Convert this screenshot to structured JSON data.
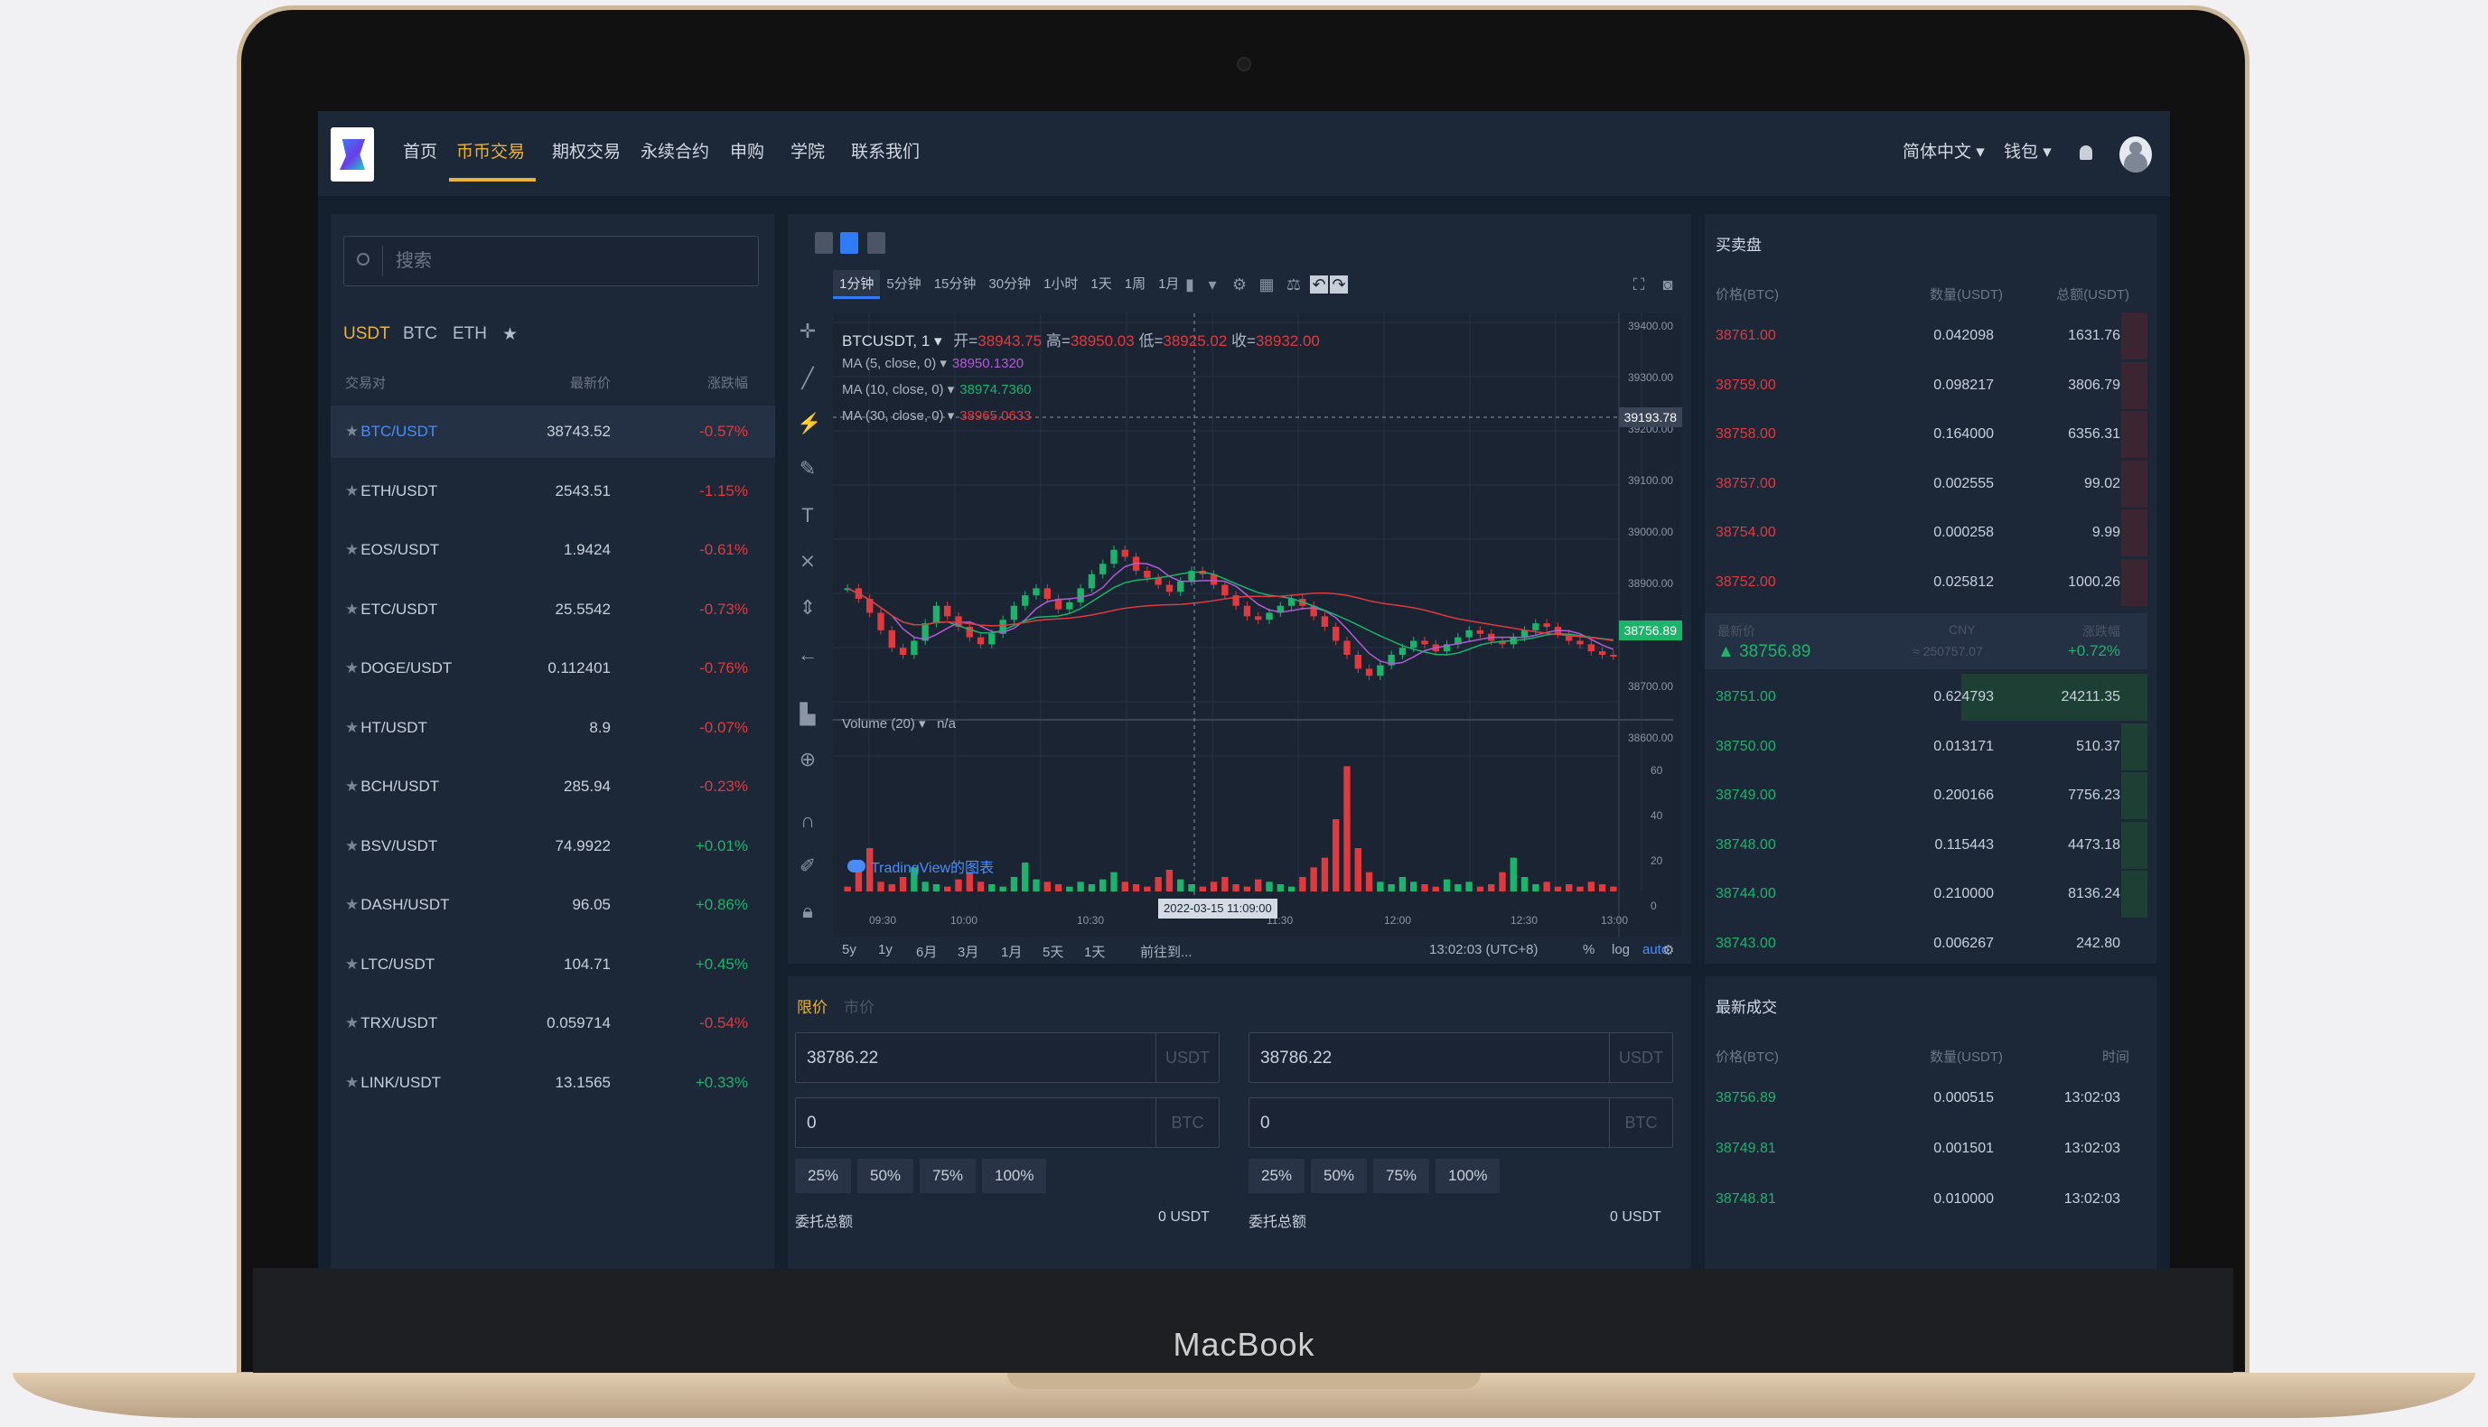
{
  "device": {
    "brand": "MacBook"
  },
  "nav": {
    "items": [
      "首页",
      "币币交易",
      "期权交易",
      "永续合约",
      "申购",
      "学院",
      "联系我们"
    ],
    "active_index": 1,
    "language": "简体中文 ▾",
    "wallet": "钱包 ▾"
  },
  "market": {
    "search_placeholder": "搜索",
    "tabs": [
      "USDT",
      "BTC",
      "ETH",
      "★"
    ],
    "active_tab": 0,
    "headers": {
      "pair": "交易对",
      "price": "最新价",
      "change": "涨跌幅"
    },
    "rows": [
      {
        "pair": "BTC/USDT",
        "price": "38743.52",
        "change": "-0.57%",
        "dir": "neg",
        "selected": true
      },
      {
        "pair": "ETH/USDT",
        "price": "2543.51",
        "change": "-1.15%",
        "dir": "neg"
      },
      {
        "pair": "EOS/USDT",
        "price": "1.9424",
        "change": "-0.61%",
        "dir": "neg"
      },
      {
        "pair": "ETC/USDT",
        "price": "25.5542",
        "change": "-0.73%",
        "dir": "neg"
      },
      {
        "pair": "DOGE/USDT",
        "price": "0.112401",
        "change": "-0.76%",
        "dir": "neg"
      },
      {
        "pair": "HT/USDT",
        "price": "8.9",
        "change": "-0.07%",
        "dir": "neg"
      },
      {
        "pair": "BCH/USDT",
        "price": "285.94",
        "change": "-0.23%",
        "dir": "neg"
      },
      {
        "pair": "BSV/USDT",
        "price": "74.9922",
        "change": "+0.01%",
        "dir": "pos"
      },
      {
        "pair": "DASH/USDT",
        "price": "96.05",
        "change": "+0.86%",
        "dir": "pos"
      },
      {
        "pair": "LTC/USDT",
        "price": "104.71",
        "change": "+0.45%",
        "dir": "pos"
      },
      {
        "pair": "TRX/USDT",
        "price": "0.059714",
        "change": "-0.54%",
        "dir": "neg"
      },
      {
        "pair": "LINK/USDT",
        "price": "13.1565",
        "change": "+0.33%",
        "dir": "pos"
      }
    ]
  },
  "chart": {
    "timeframes": [
      "1分钟",
      "5分钟",
      "15分钟",
      "30分钟",
      "1小时",
      "1天",
      "1周",
      "1月"
    ],
    "active_timeframe": 0,
    "symbol": "BTCUSDT, 1 ▾",
    "ohlc": {
      "open_label": "开=",
      "open": "38943.75",
      "high_label": "高=",
      "high": "38950.03",
      "low_label": "低=",
      "low": "38925.02",
      "close_label": "收=",
      "close": "38932.00"
    },
    "ma": [
      {
        "label": "MA (5, close, 0) ▾",
        "value": "38950.1320",
        "color": "#b45ad8"
      },
      {
        "label": "MA (10, close, 0) ▾",
        "value": "38974.7360",
        "color": "#1cb36a"
      },
      {
        "label": "MA (30, close, 0) ▾",
        "value": "38965.0633",
        "color": "#e03a3e"
      }
    ],
    "volume_label": "Volume (20) ▾",
    "volume_value": "n/a",
    "watermark": "TradingView的图表",
    "crosshair_date": "2022-03-15 11:09:00",
    "price_ticks": [
      "39400.00",
      "39300.00",
      "39200.00",
      "39100.00",
      "39000.00",
      "38900.00",
      "38800.00",
      "38700.00",
      "38600.00"
    ],
    "crosshair_price": "39193.78",
    "last_price_tag": "38756.89",
    "low_price_tag": "38756.89",
    "volume_ticks": [
      "60",
      "40",
      "20",
      "0"
    ],
    "time_ticks": [
      "09:30",
      "10:00",
      "10:30",
      "11:30",
      "12:00",
      "12:30",
      "13:00"
    ],
    "ranges": [
      "5y",
      "1y",
      "6月",
      "3月",
      "1月",
      "5天",
      "1天",
      "前往到..."
    ],
    "clock": "13:02:03 (UTC+8)",
    "scale_opts": [
      "%",
      "log",
      "auto"
    ],
    "chart_data": {
      "type": "candlestick",
      "x_label": "",
      "y_range": [
        38600,
        39400
      ],
      "ohlc_close_series": [
        38950,
        38920,
        38880,
        38830,
        38780,
        38760,
        38800,
        38850,
        38900,
        38870,
        38840,
        38810,
        38790,
        38820,
        38860,
        38900,
        38930,
        38950,
        38920,
        38890,
        38910,
        38950,
        38990,
        39020,
        39060,
        39040,
        39000,
        38980,
        38960,
        38940,
        38970,
        39000,
        38990,
        38960,
        38930,
        38900,
        38870,
        38860,
        38880,
        38900,
        38920,
        38900,
        38870,
        38840,
        38800,
        38760,
        38720,
        38700,
        38730,
        38760,
        38780,
        38800,
        38790,
        38770,
        38790,
        38810,
        38830,
        38820,
        38800,
        38790,
        38810,
        38830,
        38850,
        38840,
        38820,
        38800,
        38790,
        38770,
        38760,
        38757
      ],
      "volume_series": [
        2,
        8,
        18,
        4,
        3,
        6,
        10,
        4,
        3,
        2,
        5,
        8,
        4,
        3,
        2,
        6,
        12,
        5,
        4,
        3,
        2,
        4,
        3,
        5,
        8,
        4,
        3,
        2,
        6,
        9,
        5,
        3,
        2,
        4,
        6,
        3,
        2,
        5,
        4,
        3,
        2,
        6,
        10,
        14,
        30,
        52,
        18,
        8,
        4,
        3,
        6,
        4,
        3,
        2,
        5,
        3,
        4,
        2,
        3,
        8,
        14,
        6,
        3,
        4,
        2,
        3,
        2,
        4,
        3,
        2
      ]
    }
  },
  "order": {
    "tabs": [
      "限价",
      "市价"
    ],
    "buy": {
      "price": "38786.22",
      "price_unit": "USDT",
      "amount": "0",
      "amount_unit": "BTC",
      "total_label": "委托总额",
      "total": "0 USDT"
    },
    "sell": {
      "price": "38786.22",
      "price_unit": "USDT",
      "amount": "0",
      "amount_unit": "BTC",
      "total_label": "委托总额",
      "total": "0 USDT"
    },
    "percents": [
      "25%",
      "50%",
      "75%",
      "100%"
    ]
  },
  "book": {
    "title": "买卖盘",
    "headers": {
      "price": "价格(BTC)",
      "qty": "数量(USDT)",
      "total": "总额(USDT)"
    },
    "asks": [
      {
        "p": "38761.00",
        "q": "0.042098",
        "t": "1631.76",
        "depth": 0.02
      },
      {
        "p": "38759.00",
        "q": "0.098217",
        "t": "3806.79",
        "depth": 0.02
      },
      {
        "p": "38758.00",
        "q": "0.164000",
        "t": "6356.31",
        "depth": 0.02
      },
      {
        "p": "38757.00",
        "q": "0.002555",
        "t": "99.02",
        "depth": 0.02
      },
      {
        "p": "38754.00",
        "q": "0.000258",
        "t": "9.99",
        "depth": 0.02
      },
      {
        "p": "38752.00",
        "q": "0.025812",
        "t": "1000.26",
        "depth": 0.02
      }
    ],
    "last": {
      "label": "最新价",
      "price": "▲ 38756.89",
      "cny_label": "CNY",
      "cny": "≈ 250757.07",
      "chg_label": "涨跌幅",
      "chg": "+0.72%"
    },
    "bids": [
      {
        "p": "38751.00",
        "q": "0.624793",
        "t": "24211.35",
        "depth": 0.14
      },
      {
        "p": "38750.00",
        "q": "0.013171",
        "t": "510.37",
        "depth": 0.02
      },
      {
        "p": "38749.00",
        "q": "0.200166",
        "t": "7756.23",
        "depth": 0.02
      },
      {
        "p": "38748.00",
        "q": "0.115443",
        "t": "4473.18",
        "depth": 0.02
      },
      {
        "p": "38744.00",
        "q": "0.210000",
        "t": "8136.24",
        "depth": 0.02
      },
      {
        "p": "38743.00",
        "q": "0.006267",
        "t": "242.80",
        "depth": 0.0
      }
    ]
  },
  "trades": {
    "title": "最新成交",
    "headers": {
      "price": "价格(BTC)",
      "qty": "数量(USDT)",
      "time": "时间"
    },
    "rows": [
      {
        "p": "38756.89",
        "q": "0.000515",
        "t": "13:02:03"
      },
      {
        "p": "38749.81",
        "q": "0.001501",
        "t": "13:02:03"
      },
      {
        "p": "38748.81",
        "q": "0.010000",
        "t": "13:02:03"
      }
    ]
  }
}
